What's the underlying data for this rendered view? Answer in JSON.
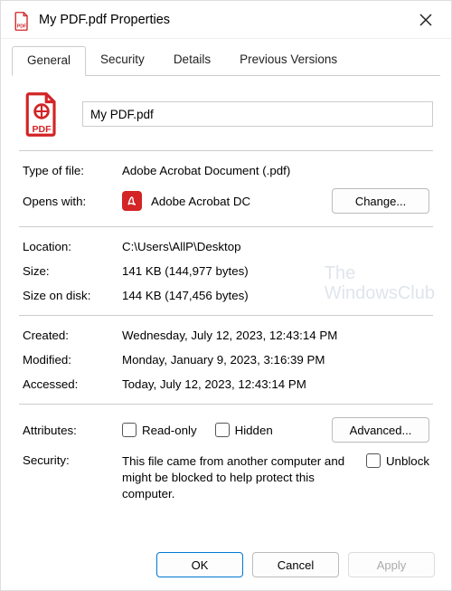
{
  "titlebar": {
    "title": "My PDF.pdf Properties"
  },
  "tabs": {
    "general": "General",
    "security": "Security",
    "details": "Details",
    "previous": "Previous Versions"
  },
  "filename": "My PDF.pdf",
  "labels": {
    "type": "Type of file:",
    "opens": "Opens with:",
    "location": "Location:",
    "size": "Size:",
    "sizeondisk": "Size on disk:",
    "created": "Created:",
    "modified": "Modified:",
    "accessed": "Accessed:",
    "attributes": "Attributes:",
    "security": "Security:"
  },
  "values": {
    "type": "Adobe Acrobat Document (.pdf)",
    "opens_app": "Adobe Acrobat DC",
    "location": "C:\\Users\\AllP\\Desktop",
    "size": "141 KB (144,977 bytes)",
    "sizeondisk": "144 KB (147,456 bytes)",
    "created": "Wednesday, July 12, 2023, 12:43:14 PM",
    "modified": "Monday, January 9, 2023, 3:16:39 PM",
    "accessed": "Today, July 12, 2023, 12:43:14 PM",
    "security_text": "This file came from another computer and might be blocked to help protect this computer."
  },
  "attr": {
    "readonly": "Read-only",
    "hidden": "Hidden",
    "unblock": "Unblock"
  },
  "buttons": {
    "change": "Change...",
    "advanced": "Advanced...",
    "ok": "OK",
    "cancel": "Cancel",
    "apply": "Apply"
  },
  "watermark": {
    "line1": "The",
    "line2": "WindowsClub"
  }
}
